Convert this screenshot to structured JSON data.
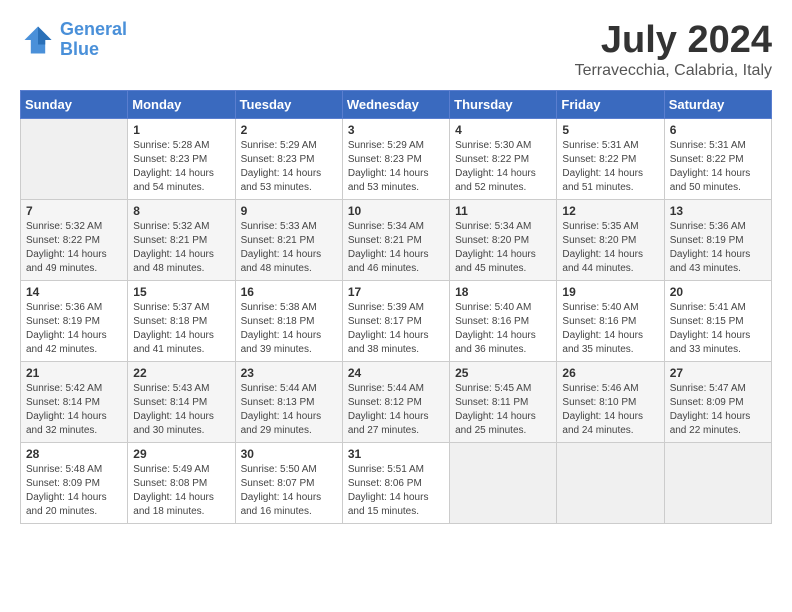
{
  "logo": {
    "line1": "General",
    "line2": "Blue"
  },
  "title": "July 2024",
  "location": "Terravecchia, Calabria, Italy",
  "weekdays": [
    "Sunday",
    "Monday",
    "Tuesday",
    "Wednesday",
    "Thursday",
    "Friday",
    "Saturday"
  ],
  "weeks": [
    [
      {
        "day": "",
        "empty": true
      },
      {
        "day": "1",
        "sunrise": "Sunrise: 5:28 AM",
        "sunset": "Sunset: 8:23 PM",
        "daylight": "Daylight: 14 hours and 54 minutes."
      },
      {
        "day": "2",
        "sunrise": "Sunrise: 5:29 AM",
        "sunset": "Sunset: 8:23 PM",
        "daylight": "Daylight: 14 hours and 53 minutes."
      },
      {
        "day": "3",
        "sunrise": "Sunrise: 5:29 AM",
        "sunset": "Sunset: 8:23 PM",
        "daylight": "Daylight: 14 hours and 53 minutes."
      },
      {
        "day": "4",
        "sunrise": "Sunrise: 5:30 AM",
        "sunset": "Sunset: 8:22 PM",
        "daylight": "Daylight: 14 hours and 52 minutes."
      },
      {
        "day": "5",
        "sunrise": "Sunrise: 5:31 AM",
        "sunset": "Sunset: 8:22 PM",
        "daylight": "Daylight: 14 hours and 51 minutes."
      },
      {
        "day": "6",
        "sunrise": "Sunrise: 5:31 AM",
        "sunset": "Sunset: 8:22 PM",
        "daylight": "Daylight: 14 hours and 50 minutes."
      }
    ],
    [
      {
        "day": "7",
        "sunrise": "Sunrise: 5:32 AM",
        "sunset": "Sunset: 8:22 PM",
        "daylight": "Daylight: 14 hours and 49 minutes."
      },
      {
        "day": "8",
        "sunrise": "Sunrise: 5:32 AM",
        "sunset": "Sunset: 8:21 PM",
        "daylight": "Daylight: 14 hours and 48 minutes."
      },
      {
        "day": "9",
        "sunrise": "Sunrise: 5:33 AM",
        "sunset": "Sunset: 8:21 PM",
        "daylight": "Daylight: 14 hours and 48 minutes."
      },
      {
        "day": "10",
        "sunrise": "Sunrise: 5:34 AM",
        "sunset": "Sunset: 8:21 PM",
        "daylight": "Daylight: 14 hours and 46 minutes."
      },
      {
        "day": "11",
        "sunrise": "Sunrise: 5:34 AM",
        "sunset": "Sunset: 8:20 PM",
        "daylight": "Daylight: 14 hours and 45 minutes."
      },
      {
        "day": "12",
        "sunrise": "Sunrise: 5:35 AM",
        "sunset": "Sunset: 8:20 PM",
        "daylight": "Daylight: 14 hours and 44 minutes."
      },
      {
        "day": "13",
        "sunrise": "Sunrise: 5:36 AM",
        "sunset": "Sunset: 8:19 PM",
        "daylight": "Daylight: 14 hours and 43 minutes."
      }
    ],
    [
      {
        "day": "14",
        "sunrise": "Sunrise: 5:36 AM",
        "sunset": "Sunset: 8:19 PM",
        "daylight": "Daylight: 14 hours and 42 minutes."
      },
      {
        "day": "15",
        "sunrise": "Sunrise: 5:37 AM",
        "sunset": "Sunset: 8:18 PM",
        "daylight": "Daylight: 14 hours and 41 minutes."
      },
      {
        "day": "16",
        "sunrise": "Sunrise: 5:38 AM",
        "sunset": "Sunset: 8:18 PM",
        "daylight": "Daylight: 14 hours and 39 minutes."
      },
      {
        "day": "17",
        "sunrise": "Sunrise: 5:39 AM",
        "sunset": "Sunset: 8:17 PM",
        "daylight": "Daylight: 14 hours and 38 minutes."
      },
      {
        "day": "18",
        "sunrise": "Sunrise: 5:40 AM",
        "sunset": "Sunset: 8:16 PM",
        "daylight": "Daylight: 14 hours and 36 minutes."
      },
      {
        "day": "19",
        "sunrise": "Sunrise: 5:40 AM",
        "sunset": "Sunset: 8:16 PM",
        "daylight": "Daylight: 14 hours and 35 minutes."
      },
      {
        "day": "20",
        "sunrise": "Sunrise: 5:41 AM",
        "sunset": "Sunset: 8:15 PM",
        "daylight": "Daylight: 14 hours and 33 minutes."
      }
    ],
    [
      {
        "day": "21",
        "sunrise": "Sunrise: 5:42 AM",
        "sunset": "Sunset: 8:14 PM",
        "daylight": "Daylight: 14 hours and 32 minutes."
      },
      {
        "day": "22",
        "sunrise": "Sunrise: 5:43 AM",
        "sunset": "Sunset: 8:14 PM",
        "daylight": "Daylight: 14 hours and 30 minutes."
      },
      {
        "day": "23",
        "sunrise": "Sunrise: 5:44 AM",
        "sunset": "Sunset: 8:13 PM",
        "daylight": "Daylight: 14 hours and 29 minutes."
      },
      {
        "day": "24",
        "sunrise": "Sunrise: 5:44 AM",
        "sunset": "Sunset: 8:12 PM",
        "daylight": "Daylight: 14 hours and 27 minutes."
      },
      {
        "day": "25",
        "sunrise": "Sunrise: 5:45 AM",
        "sunset": "Sunset: 8:11 PM",
        "daylight": "Daylight: 14 hours and 25 minutes."
      },
      {
        "day": "26",
        "sunrise": "Sunrise: 5:46 AM",
        "sunset": "Sunset: 8:10 PM",
        "daylight": "Daylight: 14 hours and 24 minutes."
      },
      {
        "day": "27",
        "sunrise": "Sunrise: 5:47 AM",
        "sunset": "Sunset: 8:09 PM",
        "daylight": "Daylight: 14 hours and 22 minutes."
      }
    ],
    [
      {
        "day": "28",
        "sunrise": "Sunrise: 5:48 AM",
        "sunset": "Sunset: 8:09 PM",
        "daylight": "Daylight: 14 hours and 20 minutes."
      },
      {
        "day": "29",
        "sunrise": "Sunrise: 5:49 AM",
        "sunset": "Sunset: 8:08 PM",
        "daylight": "Daylight: 14 hours and 18 minutes."
      },
      {
        "day": "30",
        "sunrise": "Sunrise: 5:50 AM",
        "sunset": "Sunset: 8:07 PM",
        "daylight": "Daylight: 14 hours and 16 minutes."
      },
      {
        "day": "31",
        "sunrise": "Sunrise: 5:51 AM",
        "sunset": "Sunset: 8:06 PM",
        "daylight": "Daylight: 14 hours and 15 minutes."
      },
      {
        "day": "",
        "empty": true
      },
      {
        "day": "",
        "empty": true
      },
      {
        "day": "",
        "empty": true
      }
    ]
  ]
}
